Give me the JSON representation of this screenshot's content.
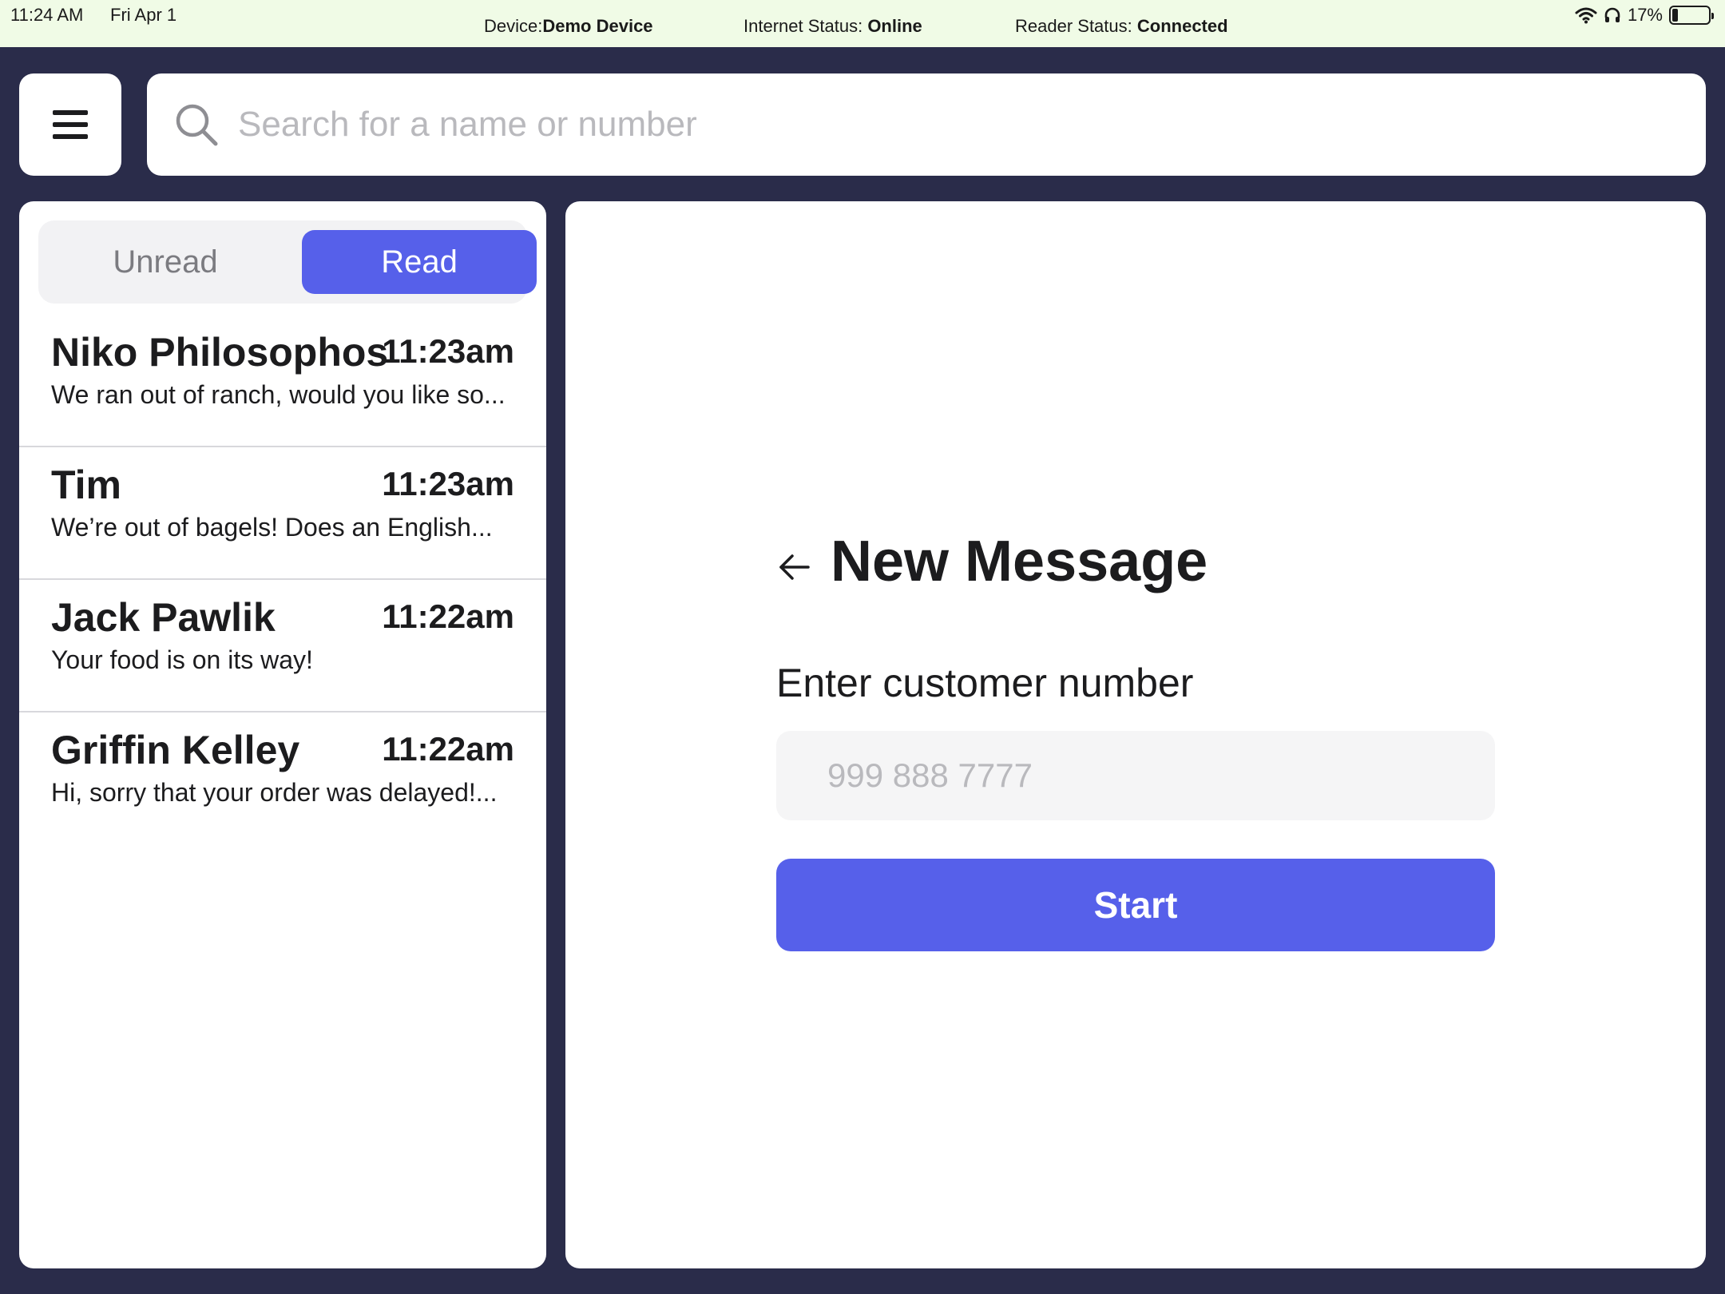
{
  "status_bar": {
    "time": "11:24 AM",
    "date": "Fri Apr 1",
    "device_label": "Device:",
    "device_value": "Demo Device",
    "internet_label": "Internet Status: ",
    "internet_value": "Online",
    "reader_label": "Reader Status: ",
    "reader_value": "Connected",
    "battery_percent": "17%",
    "battery_level": 0.17
  },
  "search": {
    "placeholder": "Search for a name or number"
  },
  "tabs": {
    "unread": "Unread",
    "read": "Read",
    "active": "read"
  },
  "conversations": [
    {
      "name": "Niko Philosophos",
      "time": "11:23am",
      "preview": "We ran out of ranch, would you like so..."
    },
    {
      "name": "Tim",
      "time": "11:23am",
      "preview": "We’re out of bagels! Does an English..."
    },
    {
      "name": "Jack Pawlik",
      "time": "11:22am",
      "preview": "Your food is on its way!"
    },
    {
      "name": "Griffin Kelley",
      "time": "11:22am",
      "preview": "Hi, sorry that your order was delayed!..."
    }
  ],
  "new_message": {
    "title": "New Message",
    "label": "Enter customer number",
    "placeholder": "999 888 7777",
    "start_label": "Start"
  },
  "colors": {
    "accent": "#5660ea",
    "background": "#2a2c4a",
    "status_bar": "#f0fbe6"
  }
}
